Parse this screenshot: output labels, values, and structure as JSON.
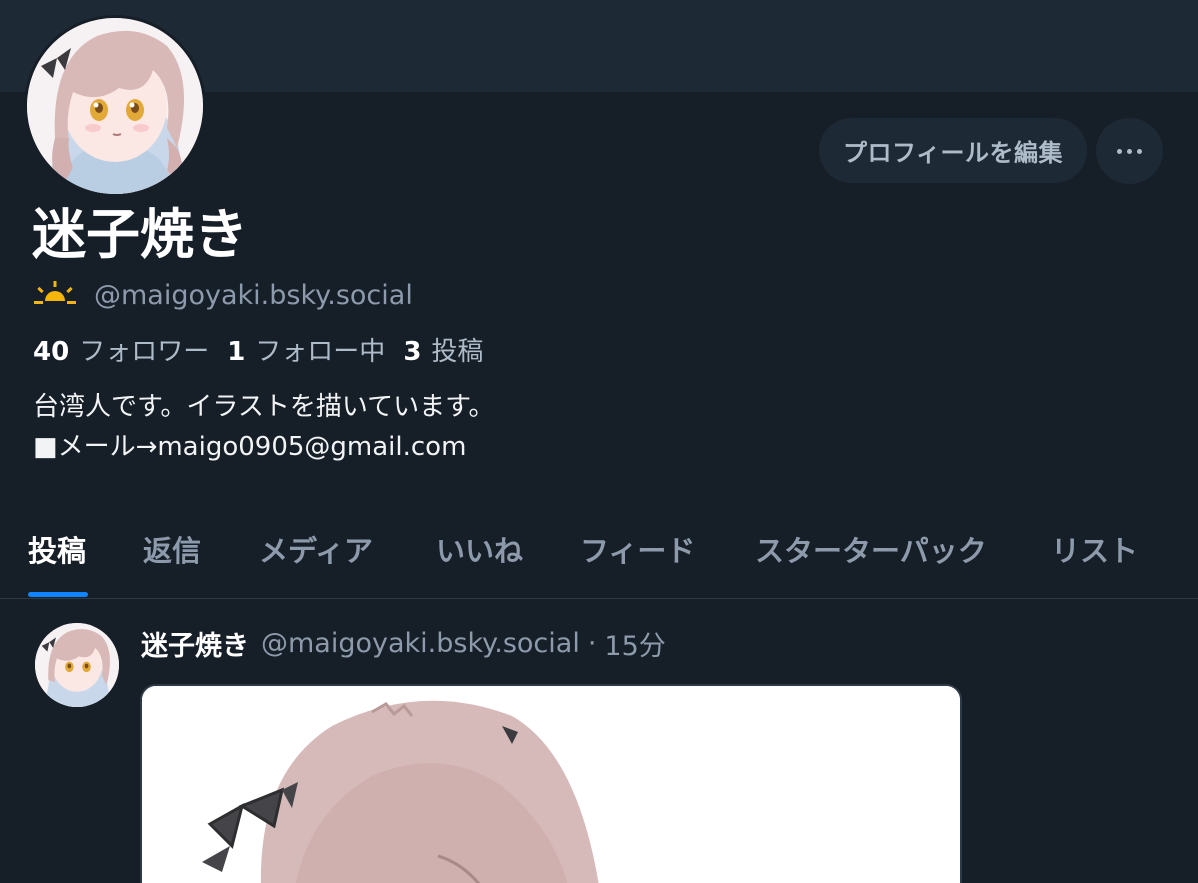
{
  "profile": {
    "display_name": "迷子焼き",
    "handle": "@maigoyaki.bsky.social",
    "handle_icon": "sunrise-icon",
    "edit_button_label": "プロフィールを編集",
    "more_icon": "ellipsis-icon",
    "stats": {
      "followers_count": "40",
      "followers_label": "フォロワー",
      "following_count": "1",
      "following_label": "フォロー中",
      "posts_count": "3",
      "posts_label": "投稿"
    },
    "bio_lines": [
      "台湾人です。イラストを描いています。",
      "■メール→maigo0905@gmail.com"
    ]
  },
  "tabs": [
    {
      "label": "投稿",
      "active": true
    },
    {
      "label": "返信",
      "active": false
    },
    {
      "label": "メディア",
      "active": false
    },
    {
      "label": "いいね",
      "active": false
    },
    {
      "label": "フィード",
      "active": false
    },
    {
      "label": "スターターパック",
      "active": false
    },
    {
      "label": "リスト",
      "active": false
    }
  ],
  "post": {
    "author": "迷子焼き",
    "handle": "@maigoyaki.bsky.social",
    "separator": "·",
    "time": "15分"
  },
  "colors": {
    "background": "#161e27",
    "banner": "#1e2936",
    "accent": "#1083fe",
    "sun_icon": "#f5b50a"
  }
}
